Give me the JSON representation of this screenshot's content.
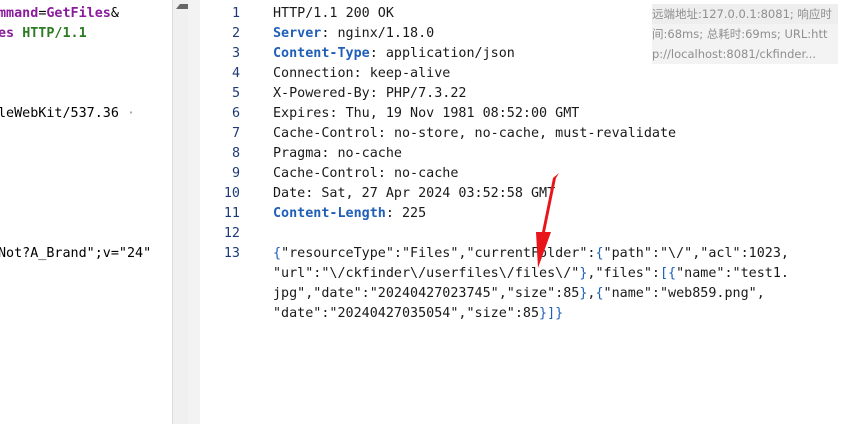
{
  "request_pane": {
    "lines": [
      {
        "parts": [
          {
            "t": "mmand",
            "c": "kw-purple"
          },
          {
            "t": "=",
            "c": "plain"
          },
          {
            "t": "GetFiles",
            "c": "kw-purple"
          },
          {
            "t": "&",
            "c": "plain"
          }
        ]
      },
      {
        "parts": [
          {
            "t": "es",
            "c": "kw-purple"
          },
          {
            "t": " ",
            "c": "dot"
          },
          {
            "t": "HTTP/1.1",
            "c": "kw-green"
          }
        ]
      },
      {
        "parts": []
      },
      {
        "parts": []
      },
      {
        "parts": []
      },
      {
        "parts": [
          {
            "t": "leWebKit/537.36",
            "c": "plain"
          },
          {
            "t": " ·",
            "c": "dot"
          }
        ]
      },
      {
        "parts": []
      },
      {
        "parts": []
      },
      {
        "parts": []
      },
      {
        "parts": []
      },
      {
        "parts": []
      },
      {
        "parts": []
      },
      {
        "parts": [
          {
            "t": "Not?A_Brand\";v=\"24\"",
            "c": "plain"
          }
        ]
      }
    ]
  },
  "response_pane": {
    "line_numbers": [
      "1",
      "2",
      "3",
      "4",
      "5",
      "6",
      "7",
      "8",
      "9",
      "10",
      "11",
      "12",
      "13"
    ],
    "headers": [
      {
        "key": "HTTP/1.1",
        "sep": " ",
        "val": "200 OK",
        "bold": false,
        "status": true
      },
      {
        "key": "Server",
        "sep": ": ",
        "val": "nginx/1.18.0",
        "bold": true
      },
      {
        "key": "Content-Type",
        "sep": ": ",
        "val": "application/json",
        "bold": true
      },
      {
        "key": "Connection",
        "sep": ": ",
        "val": "keep-alive",
        "bold": false
      },
      {
        "key": "X-Powered-By",
        "sep": ": ",
        "val": "PHP/7.3.22",
        "bold": false
      },
      {
        "key": "Expires",
        "sep": ": ",
        "val": "Thu, 19 Nov 1981 08:52:00 GMT",
        "bold": false
      },
      {
        "key": "Cache-Control",
        "sep": ": ",
        "val": "no-store, no-cache, must-revalidate",
        "bold": false
      },
      {
        "key": "Pragma",
        "sep": ": ",
        "val": "no-cache",
        "bold": false
      },
      {
        "key": "Cache-Control",
        "sep": ": ",
        "val": "no-cache",
        "bold": false
      },
      {
        "key": "Date",
        "sep": ": ",
        "val": "Sat, 27 Apr 2024 03:52:58 GMT",
        "bold": false
      },
      {
        "key": "Content-Length",
        "sep": ": ",
        "val": "225",
        "bold": true
      }
    ],
    "body_lines": [
      "{\"resourceType\":\"Files\",\"currentFolder\":{\"path\":\"\\/\",\"acl\":1023,",
      "\"url\":\"\\/ckfinder\\/userfiles\\/files\\/\"},\"files\":[{\"name\":\"test1.",
      "jpg\",\"date\":\"20240427023745\",\"size\":85},{\"name\":\"web859.png\",",
      "\"date\":\"20240427035054\",\"size\":85}]}"
    ]
  },
  "tooltip": {
    "lines": [
      "远端地址:127.0.0.1:8081; 响应时",
      "间:68ms; 总耗时:69ms; URL:htt",
      "p://localhost:8081/ckfinder..."
    ]
  },
  "colors": {
    "header_key_bold": "#1f5fb8",
    "line_number": "#1f3a78",
    "arrow": "#e8161b"
  }
}
